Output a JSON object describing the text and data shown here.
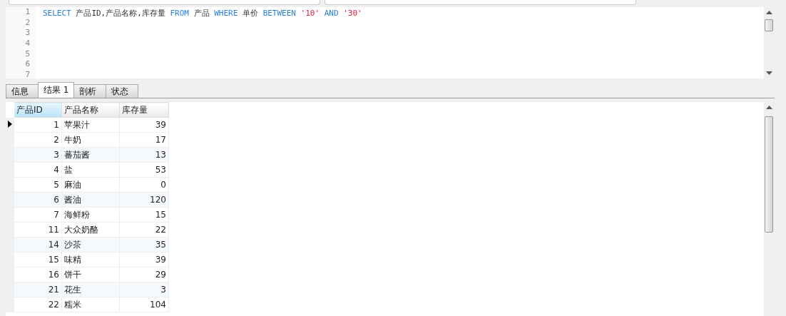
{
  "editor": {
    "line_numbers": [
      "1",
      "2",
      "3",
      "4",
      "5",
      "6",
      "7"
    ],
    "tokens": [
      {
        "kind": "keyword",
        "text": "SELECT"
      },
      {
        "kind": "plain",
        "text": "产品ID,产品名称,库存量"
      },
      {
        "kind": "keyword",
        "text": "FROM"
      },
      {
        "kind": "plain",
        "text": "产品"
      },
      {
        "kind": "keyword",
        "text": "WHERE"
      },
      {
        "kind": "plain",
        "text": "单价"
      },
      {
        "kind": "keyword",
        "text": "BETWEEN"
      },
      {
        "kind": "string",
        "text": "'10'"
      },
      {
        "kind": "keyword",
        "text": "AND"
      },
      {
        "kind": "string",
        "text": "'30'"
      }
    ]
  },
  "tabs": [
    {
      "label": "信息",
      "selected": false
    },
    {
      "label": "结果 1",
      "selected": true
    },
    {
      "label": "剖析",
      "selected": false
    },
    {
      "label": "状态",
      "selected": false
    }
  ],
  "table": {
    "columns": [
      {
        "label": "产品ID",
        "selected": true
      },
      {
        "label": "产品名称",
        "selected": false
      },
      {
        "label": "库存量",
        "selected": false
      }
    ],
    "rows": [
      {
        "selected": true,
        "cells": [
          "1",
          "苹果汁",
          "39"
        ]
      },
      {
        "selected": false,
        "cells": [
          "2",
          "牛奶",
          "17"
        ]
      },
      {
        "selected": false,
        "cells": [
          "3",
          "蕃茄酱",
          "13"
        ]
      },
      {
        "selected": false,
        "cells": [
          "4",
          "盐",
          "53"
        ]
      },
      {
        "selected": false,
        "cells": [
          "5",
          "麻油",
          "0"
        ]
      },
      {
        "selected": false,
        "cells": [
          "6",
          "酱油",
          "120"
        ]
      },
      {
        "selected": false,
        "cells": [
          "7",
          "海鲜粉",
          "15"
        ]
      },
      {
        "selected": false,
        "cells": [
          "11",
          "大众奶酪",
          "22"
        ]
      },
      {
        "selected": false,
        "cells": [
          "14",
          "沙茶",
          "35"
        ]
      },
      {
        "selected": false,
        "cells": [
          "15",
          "味精",
          "39"
        ]
      },
      {
        "selected": false,
        "cells": [
          "16",
          "饼干",
          "29"
        ]
      },
      {
        "selected": false,
        "cells": [
          "21",
          "花生",
          "3"
        ]
      },
      {
        "selected": false,
        "cells": [
          "22",
          "糯米",
          "104"
        ]
      }
    ]
  }
}
